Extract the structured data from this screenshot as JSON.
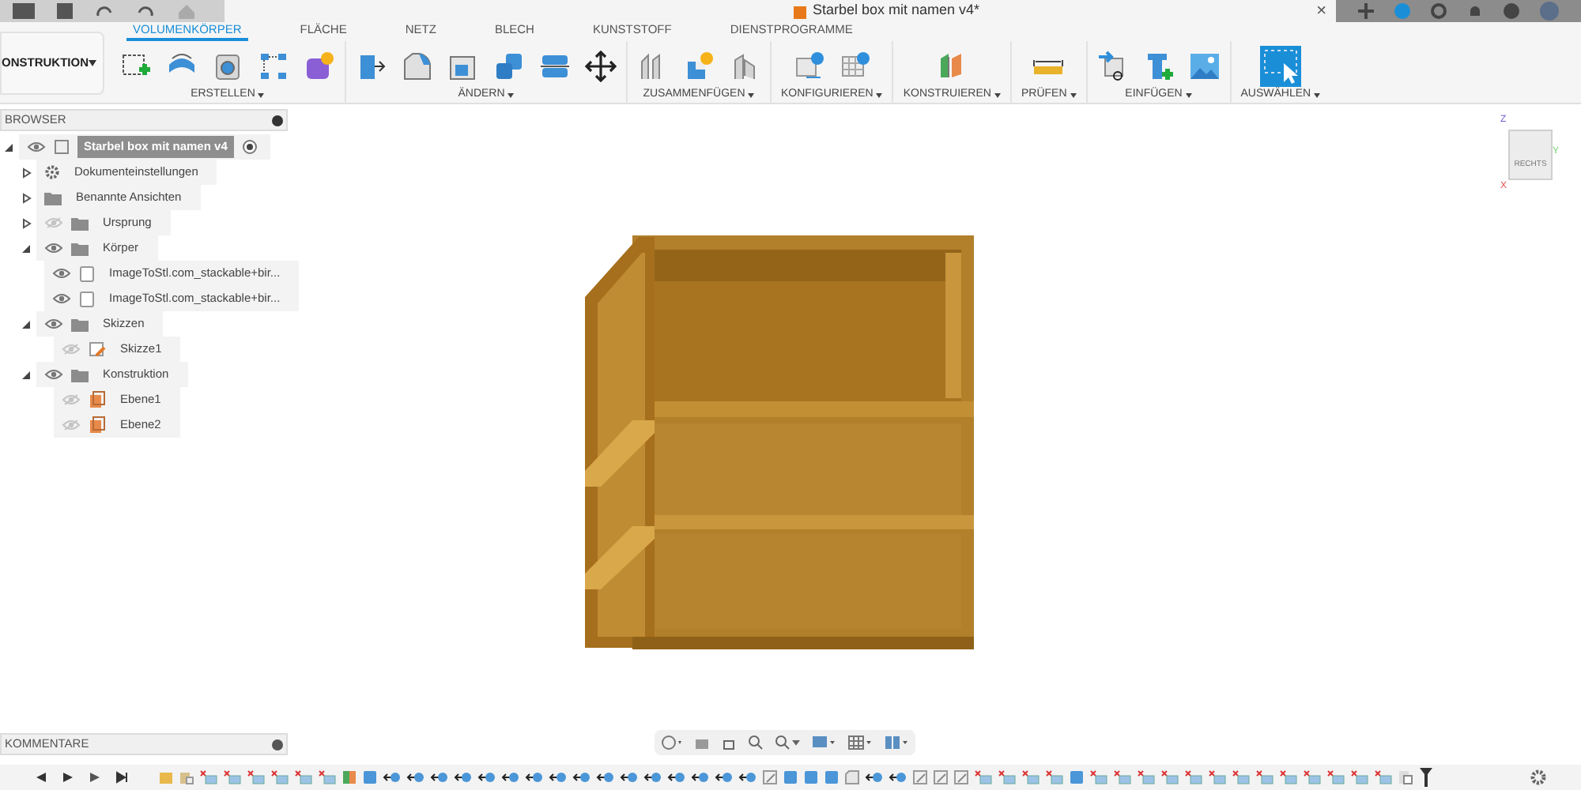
{
  "title_bar": {
    "document_title": "Starbel box mit namen v4*",
    "close": "×"
  },
  "workspace_menu": {
    "label": "ONSTRUKTION"
  },
  "tabs": [
    {
      "label": "VOLUMENKÖRPER",
      "selected": true
    },
    {
      "label": "FLÄCHE",
      "selected": false
    },
    {
      "label": "NETZ",
      "selected": false
    },
    {
      "label": "BLECH",
      "selected": false
    },
    {
      "label": "KUNSTSTOFF",
      "selected": false
    },
    {
      "label": "DIENSTPROGRAMME",
      "selected": false
    }
  ],
  "toolbar_groups": [
    {
      "label": "ERSTELLEN"
    },
    {
      "label": "ÄNDERN"
    },
    {
      "label": "ZUSAMMENFÜGEN"
    },
    {
      "label": "KONFIGURIEREN"
    },
    {
      "label": "KONSTRUIEREN"
    },
    {
      "label": "PRÜFEN"
    },
    {
      "label": "EINFÜGEN"
    },
    {
      "label": "AUSWÄHLEN"
    }
  ],
  "browser": {
    "title": "BROWSER",
    "tree": [
      {
        "label": "Starbel box mit namen v4",
        "kind": "component",
        "selected": true,
        "expanded": true,
        "visible": true,
        "children": [
          {
            "label": "Dokumenteinstellungen",
            "kind": "settings",
            "selected": false,
            "expanded": false
          },
          {
            "label": "Benannte Ansichten",
            "kind": "folder",
            "selected": false,
            "expanded": false
          },
          {
            "label": "Ursprung",
            "kind": "folder",
            "selected": false,
            "expanded": false,
            "visible": false
          },
          {
            "label": "Körper",
            "kind": "folder",
            "selected": false,
            "expanded": true,
            "visible": true,
            "children": [
              {
                "label": "ImageToStl.com_stackable+bir...",
                "kind": "body",
                "selected": false,
                "visible": true
              },
              {
                "label": "ImageToStl.com_stackable+bir...",
                "kind": "body",
                "selected": false,
                "visible": true
              }
            ]
          },
          {
            "label": "Skizzen",
            "kind": "folder",
            "selected": false,
            "expanded": true,
            "visible": true,
            "children": [
              {
                "label": "Skizze1",
                "kind": "sketch",
                "selected": false,
                "visible": false
              }
            ]
          },
          {
            "label": "Konstruktion",
            "kind": "folder",
            "selected": false,
            "expanded": true,
            "visible": true,
            "children": [
              {
                "label": "Ebene1",
                "kind": "plane",
                "selected": false,
                "visible": false
              },
              {
                "label": "Ebene2",
                "kind": "plane",
                "selected": false,
                "visible": false
              }
            ]
          }
        ]
      }
    ]
  },
  "view_cube": {
    "face": "RECHTS",
    "axes": [
      "Z",
      "Y",
      "X"
    ]
  },
  "comments": {
    "title": "KOMMENTARE"
  }
}
